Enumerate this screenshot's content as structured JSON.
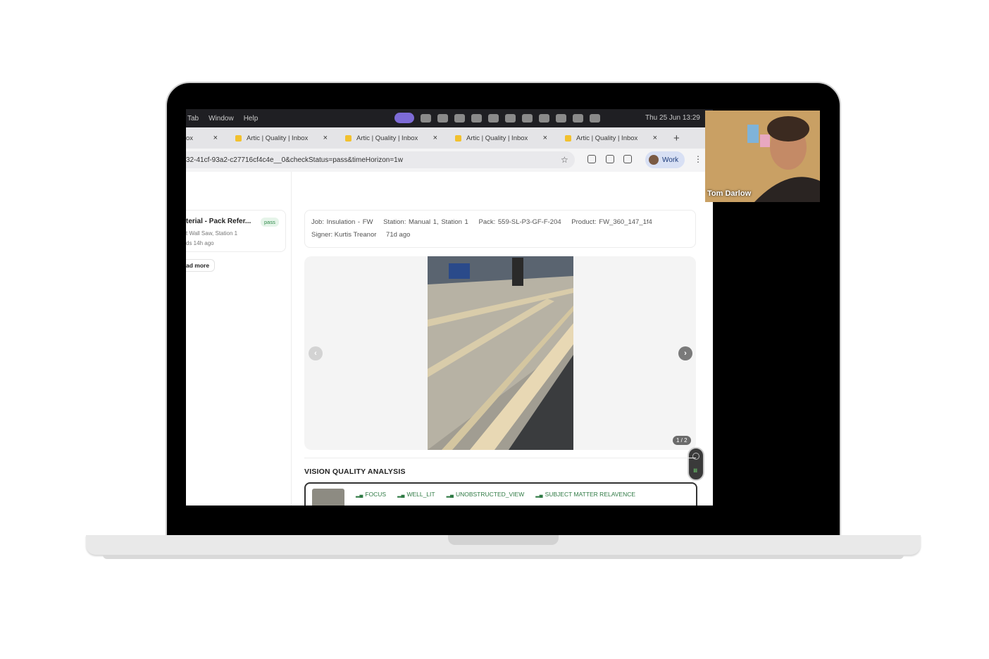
{
  "menubar": {
    "items": [
      "Tab",
      "Window",
      "Help"
    ],
    "clock": "Thu 25 Jun 13:29"
  },
  "tabs": {
    "first_label": "ox",
    "items": [
      {
        "label": "Artic | Quality | Inbox"
      },
      {
        "label": "Artic | Quality | Inbox"
      },
      {
        "label": "Artic | Quality | Inbox"
      },
      {
        "label": "Artic | Quality | Inbox"
      }
    ],
    "close_glyph": "×",
    "new_tab": "+"
  },
  "address": {
    "url": "32-41cf-93a2-c27716cf4c4e__0&checkStatus=pass&timeHorizon=1w",
    "profile": "Work"
  },
  "sidebar": {
    "card": {
      "title": "terial - Pack Refer...",
      "badge": "pass",
      "station": "t Wall Saw, Station 1",
      "time": "ds  14h ago"
    },
    "read_more": "ad more"
  },
  "detail": {
    "job": "Job: Insulation - FW",
    "station": "Station: Manual 1, Station 1",
    "pack": "Pack: 559-SL-P3-GF-F-204",
    "product": "Product: FW_360_147_1f4",
    "signer": "Signer: Kurtis Treanor",
    "age": "71d ago"
  },
  "carousel": {
    "counter": "1 / 2",
    "prev_glyph": "‹",
    "next_glyph": "›"
  },
  "analysis": {
    "title": "VISION QUALITY ANALYSIS",
    "tags": [
      "FOCUS",
      "WELL_LIT",
      "UNOBSTRUCTED_VIEW",
      "SUBJECT MATTER RELAVENCE"
    ]
  },
  "video": {
    "participant": "Tom Darlow"
  },
  "colors": {
    "accent": "#7d6bd6",
    "pass_green": "#2f8a4a",
    "tab_favicon": "#f2c12e"
  }
}
